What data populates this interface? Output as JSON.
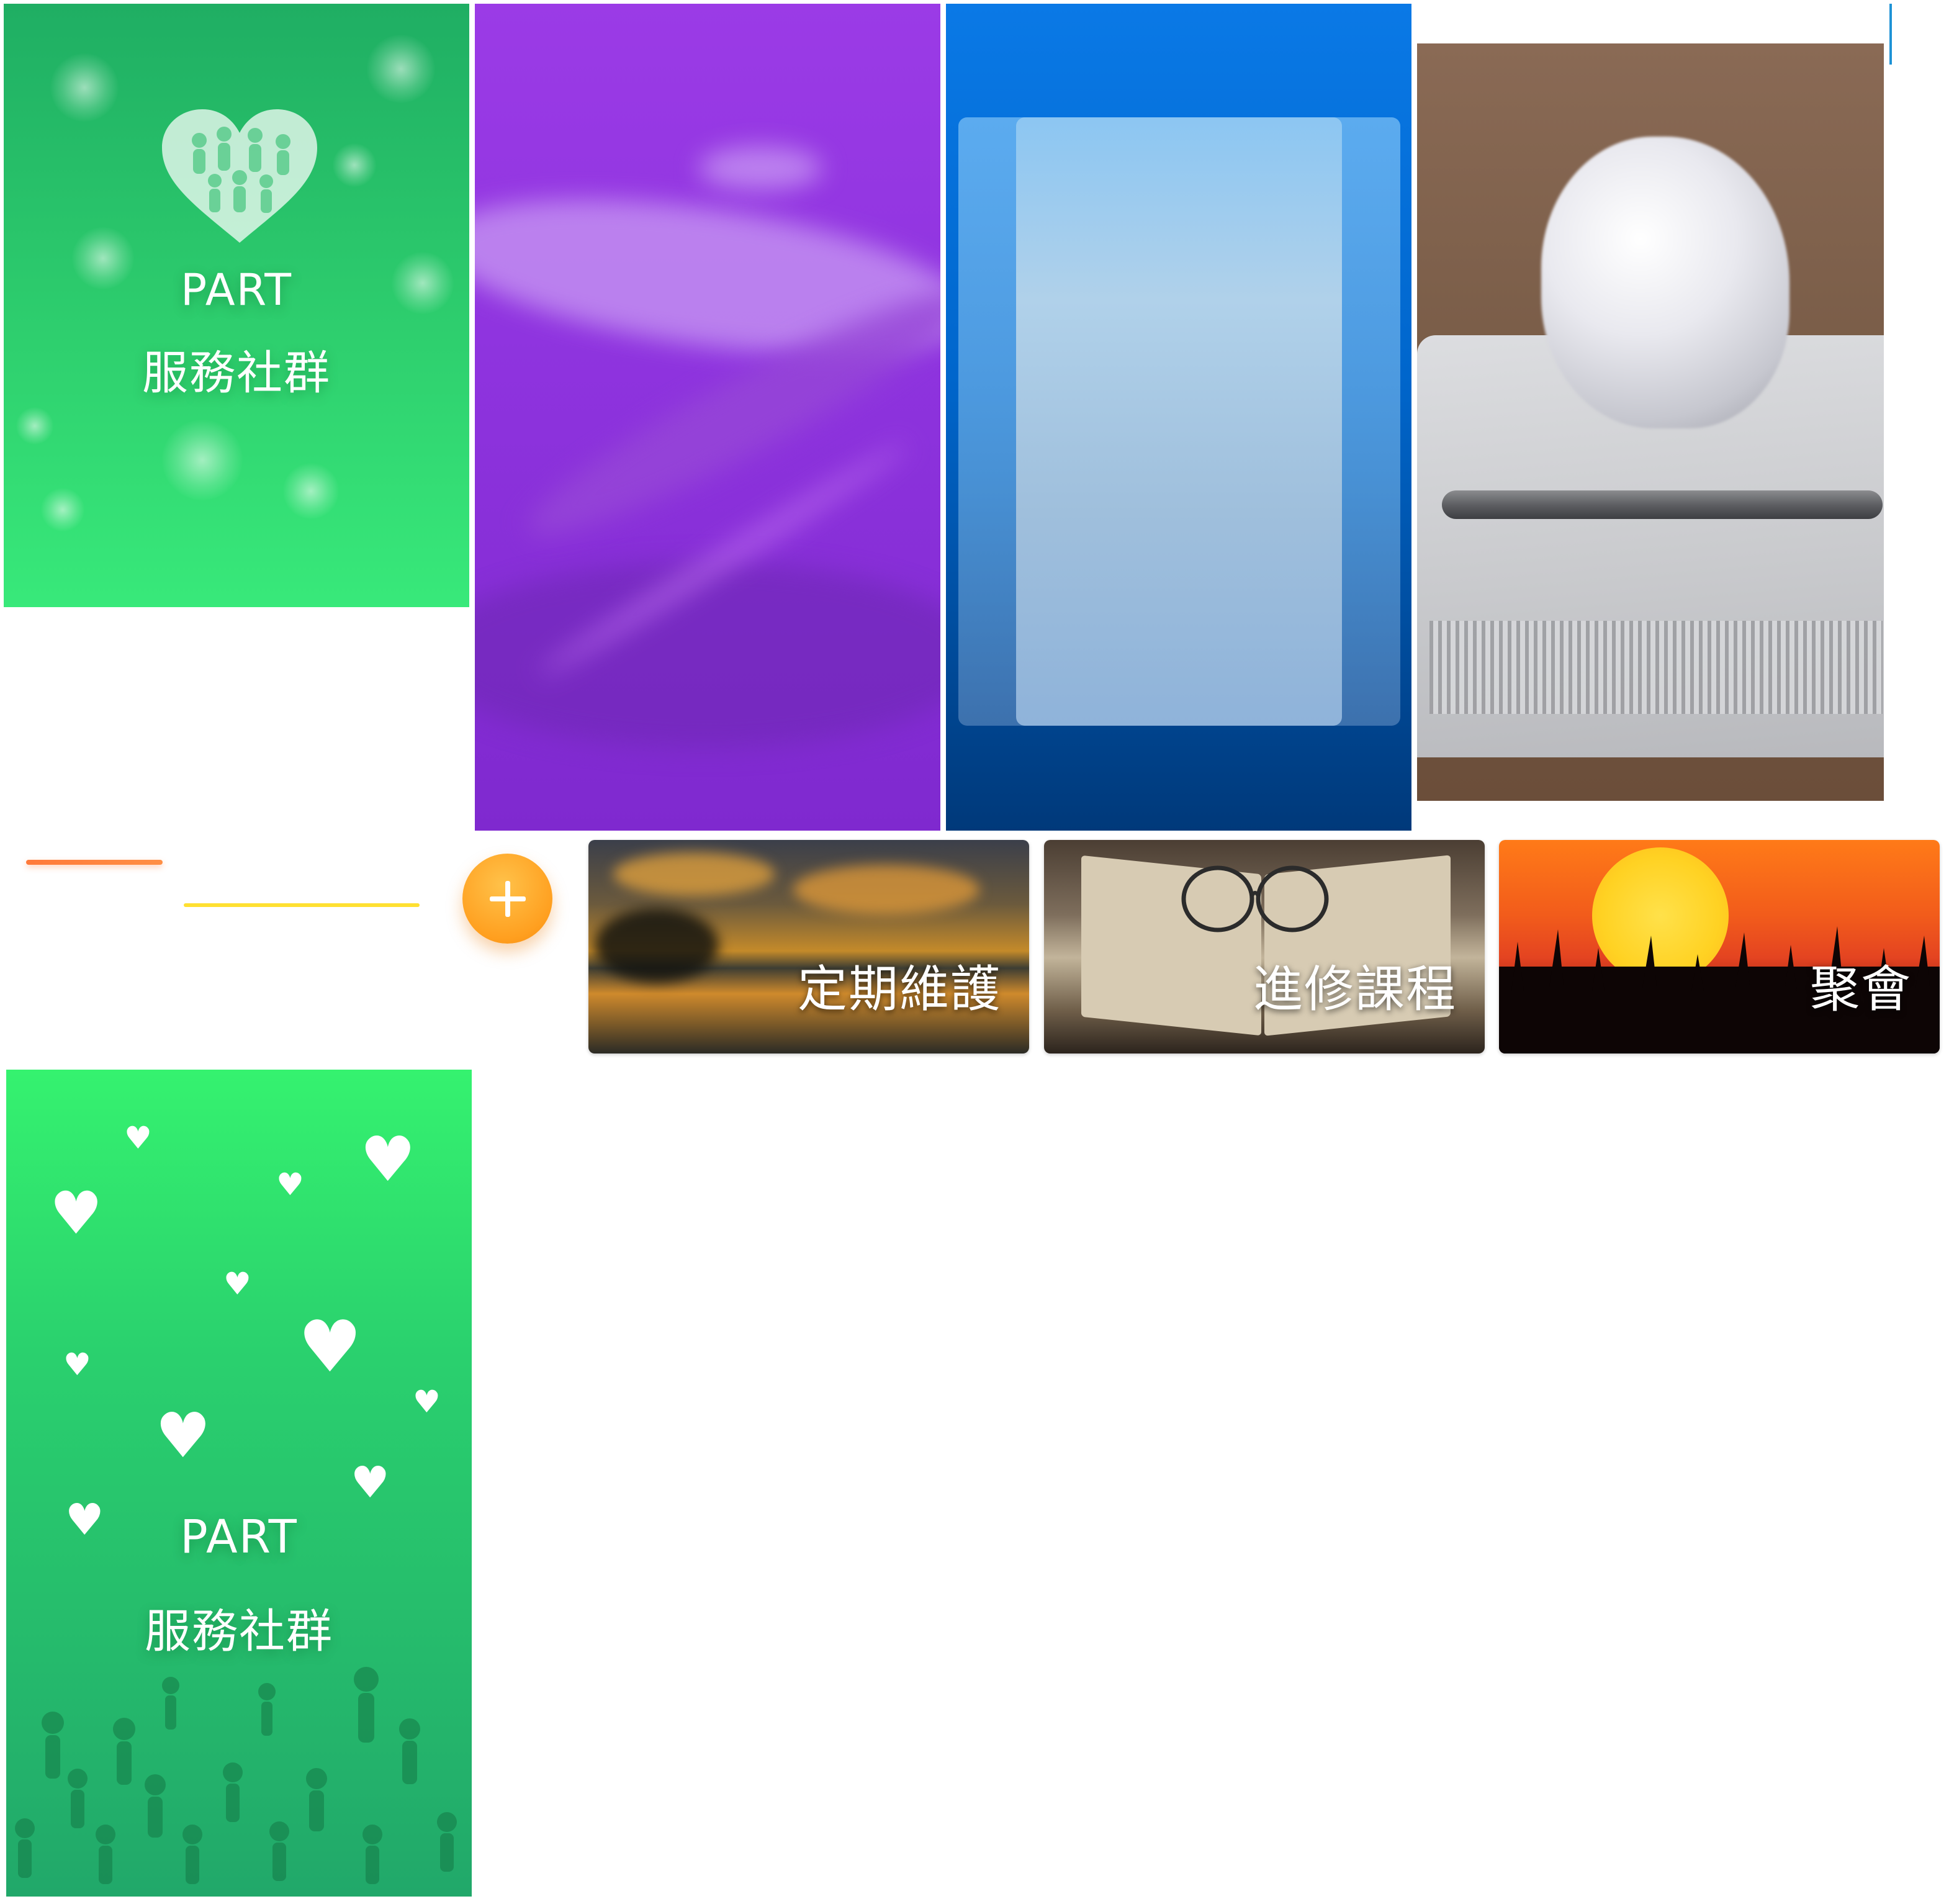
{
  "cards": {
    "green_top": {
      "line1": "PART",
      "line2": "服務社群"
    },
    "green_bottom": {
      "line1": "PART",
      "line2": "服務社群"
    }
  },
  "add_button": {
    "icon": "plus-icon"
  },
  "tiles": [
    {
      "label": "定期維護"
    },
    {
      "label": "進修課程"
    },
    {
      "label": "聚會"
    }
  ],
  "colors": {
    "accent_orange": "#ff9f1f",
    "green": "#2ecf6e",
    "purple": "#8f34df",
    "blue": "#0066cc"
  }
}
